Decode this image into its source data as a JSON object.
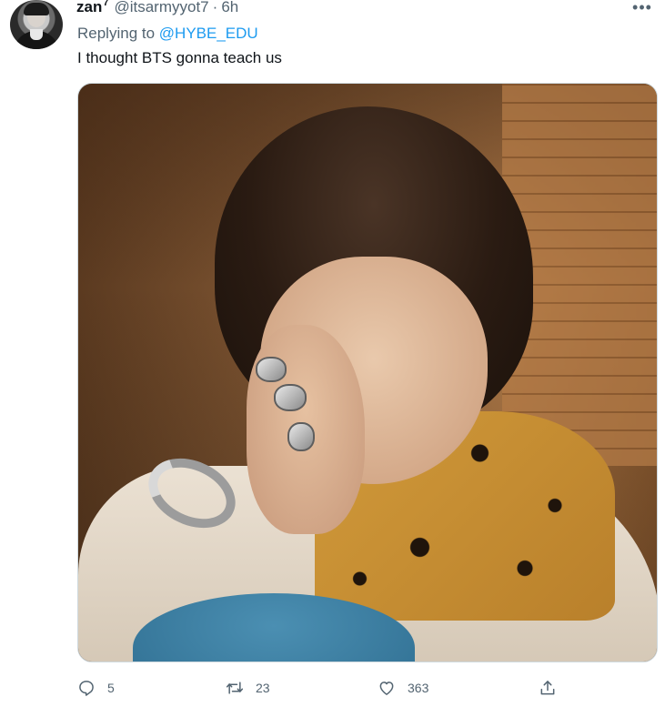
{
  "tweet": {
    "display_name": "zan",
    "name_superscript": "7",
    "handle": "@itsarmyyot7",
    "separator": "·",
    "time": "6h",
    "more_label": "•••",
    "reply_prefix": "Replying to",
    "reply_to": "@HYBE_EDU",
    "text": "I thought BTS gonna teach us"
  },
  "actions": {
    "reply_count": "5",
    "retweet_count": "23",
    "like_count": "363",
    "icons": [
      "reply-icon",
      "retweet-icon",
      "heart-icon",
      "share-icon"
    ]
  },
  "colors": {
    "link": "#1d9bf0",
    "secondary_text": "#536471",
    "primary_text": "#0f1419"
  }
}
